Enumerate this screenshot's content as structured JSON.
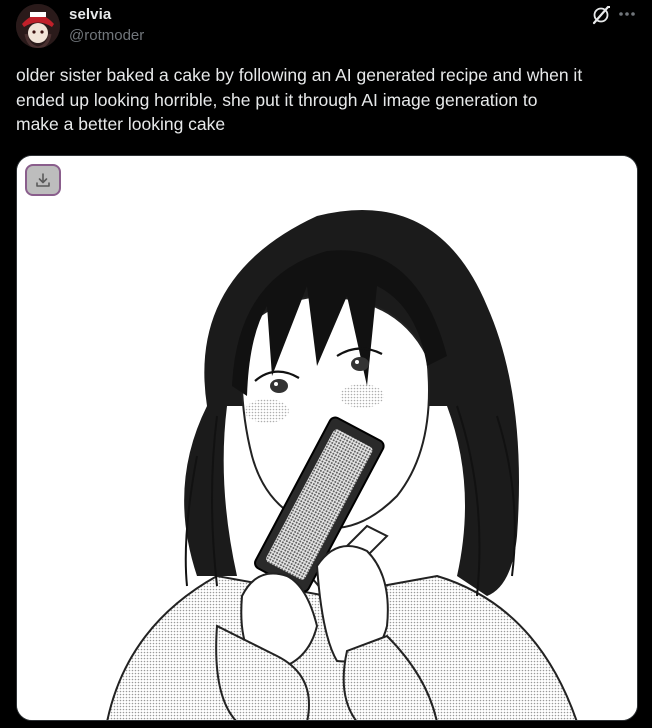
{
  "user": {
    "display_name": "selvia",
    "handle": "@rotmoder",
    "avatar_icon": "avatar-image"
  },
  "header_actions": {
    "grok_icon": "grok-icon",
    "more_icon": "more-horizontal-icon"
  },
  "tweet": {
    "text": "older sister baked a cake by following an AI generated recipe and when it\nended up looking horrible, she put it through AI image generation to\nmake a better looking cake"
  },
  "media": {
    "download_icon": "download-icon",
    "image_description_icon": "manga-illustration-image"
  },
  "colors": {
    "background": "#000000",
    "primary_text": "#e7e9ea",
    "secondary_text": "#71767b",
    "download_border": "#8a5e8c"
  }
}
